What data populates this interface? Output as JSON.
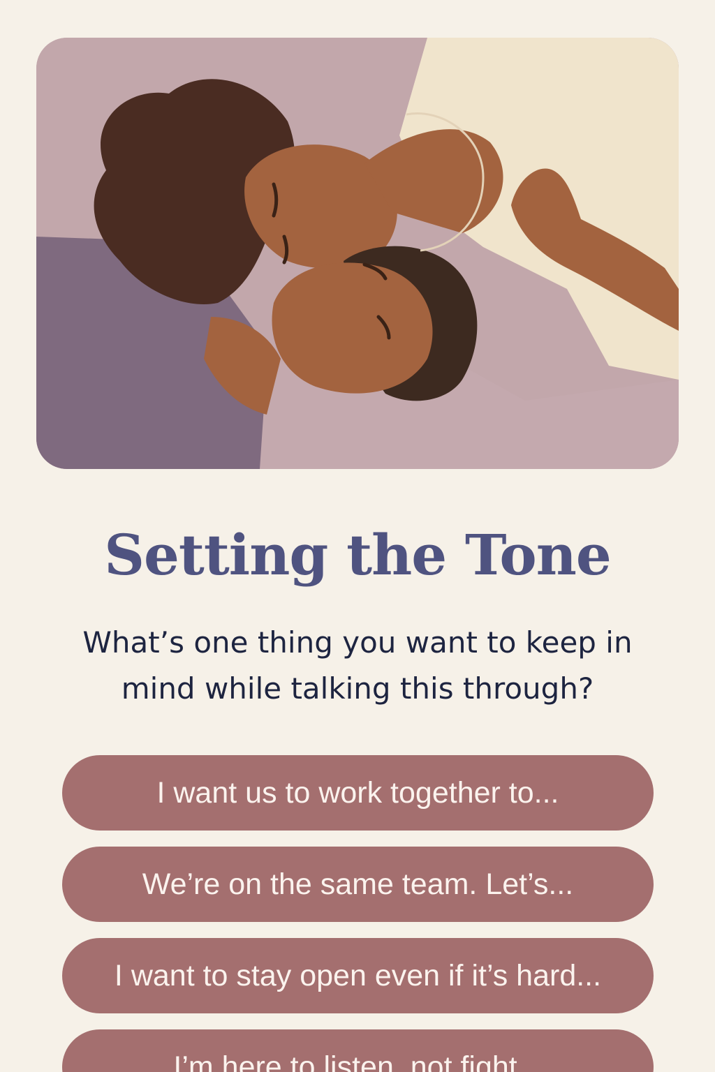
{
  "hero": {
    "illustration": "two-people-lying-together-illustration"
  },
  "title": "Setting the Tone",
  "prompt": "What’s one thing you want to keep in mind while talking this through?",
  "options": [
    {
      "label": "I want us to work together to..."
    },
    {
      "label": "We’re on the same team. Let’s..."
    },
    {
      "label": "I want to stay open even if it’s hard..."
    },
    {
      "label": "I’m here to listen, not fight..."
    }
  ],
  "colors": {
    "background": "#f6f1e8",
    "title": "#4f5380",
    "prompt": "#1d2440",
    "option_button": "#a46f6f",
    "option_text": "#fbf3ee"
  }
}
